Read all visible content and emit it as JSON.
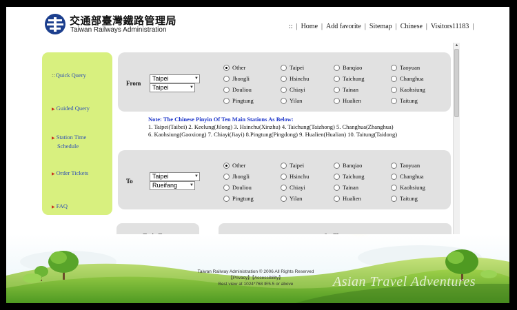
{
  "header": {
    "title_cn": "交通部臺灣鐵路管理局",
    "title_en": "Taiwan Railways Administration",
    "nav": {
      "grip": "::",
      "home": "Home",
      "add_favorite": "Add favorite",
      "sitemap": "Sitemap",
      "chinese": "Chinese",
      "visitors": "Visitors11183"
    }
  },
  "sidebar": {
    "items": [
      {
        "label": "Quick Query"
      },
      {
        "label": "Guided Query"
      },
      {
        "label": "Station Time"
      },
      {
        "label": "Schedule"
      },
      {
        "label": "Order Tickets"
      },
      {
        "label": "FAQ"
      }
    ]
  },
  "stations": [
    "Other",
    "Taipei",
    "Banqiao",
    "Taoyuan",
    "Jhongli",
    "Hsinchu",
    "Taichung",
    "Changhua",
    "Douliou",
    "Chiayi",
    "Tainan",
    "Kaohsiung",
    "Pingtung",
    "Yilan",
    "Hualien",
    "Taitung"
  ],
  "from_panel": {
    "label": "From",
    "region_select": "Taipei",
    "station_select": "Taipei",
    "selected_station": "Other"
  },
  "to_panel": {
    "label": "To",
    "region_select": "Taipei",
    "station_select": "Rueifang",
    "selected_station": "Other"
  },
  "note": {
    "title": "Note: The Chinese Pinyin Of Ten Main Stations As Below:",
    "line1": "1. Taipei(Taibei) 2. Keelung(Jilong) 3. Hsinchu(Xinzhu) 4. Taichung(Taizhong) 5. Changhua(Zhanghua)",
    "line2": "6. Kaohsiung(Gaoxiong) 7. Chiayi(Jiayi) 8.Pingtung(Pingdong) 9. Hualien(Hualian) 10. Taitung(Taidong)"
  },
  "tabs": {
    "train_types": "Train Types",
    "set_time": "Set Time"
  },
  "footer": {
    "line1": "Taiwan Railway Administration © 2006 All Rights Reserved",
    "line2": "【Privacy】【Accessibility】",
    "line3": "Best view at 1024*768 IE5.5 or above"
  },
  "watermark": "Asian Travel Adventures",
  "colors": {
    "menu_bg": "#d8f07f",
    "link": "#2e4fb4",
    "panel_bg": "#e1e1e1",
    "note_title": "#1d35c9",
    "logo": "#1c3f8e"
  },
  "icons": {
    "logo": "railway-logo-icon",
    "menu_bullet": "arrow-right-icon",
    "select_arrow": "chevron-down-icon"
  }
}
